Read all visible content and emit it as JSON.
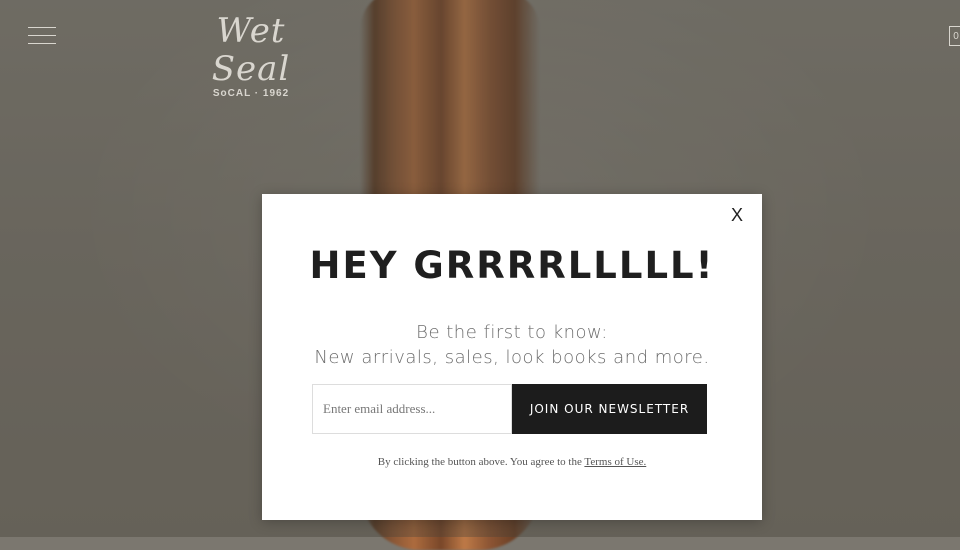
{
  "header": {
    "logo_main": "Wet Seal",
    "logo_sub": "SoCAL · 1962",
    "cart_count": "0"
  },
  "modal": {
    "close_label": "X",
    "title": "HEY GRRRRLLLLL!",
    "subtitle_line1": "Be the first to know:",
    "subtitle_line2": "New arrivals, sales, look books and more.",
    "email_placeholder": "Enter email address...",
    "join_label": "JOIN OUR NEWSLETTER",
    "terms_text": "By clicking the button above. You agree to the",
    "terms_link": "Terms of Use."
  },
  "icons": {
    "menu": "hamburger-menu-icon",
    "cart": "shopping-bag-icon"
  }
}
